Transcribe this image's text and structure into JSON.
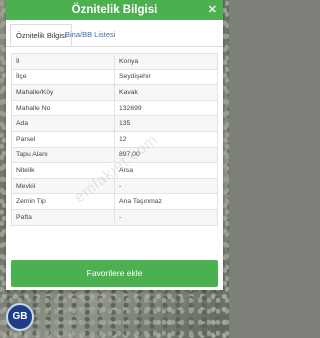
{
  "dialog": {
    "title": "Öznitelik Bilgisi",
    "close_icon_glyph": "✕",
    "tabs": [
      {
        "label": "Öznitelik Bilgisi"
      },
      {
        "label": "Bina/BB Listesi"
      }
    ],
    "rows": [
      {
        "label": "İl",
        "value": "Konya"
      },
      {
        "label": "İlçe",
        "value": "Seydişehir"
      },
      {
        "label": "Mahalle/Köy",
        "value": "Kavak"
      },
      {
        "label": "Mahalle No",
        "value": "132699"
      },
      {
        "label": "Ada",
        "value": "135"
      },
      {
        "label": "Parsel",
        "value": "12"
      },
      {
        "label": "Tapu Alanı",
        "value": "897,00"
      },
      {
        "label": "Nitelik",
        "value": "Arsa"
      },
      {
        "label": "Mevkii",
        "value": "-"
      },
      {
        "label": "Zemin Tip",
        "value": "Ana Taşınmaz"
      },
      {
        "label": "Pafta",
        "value": "-"
      }
    ],
    "favorite_button": "Favorilere ekle"
  },
  "watermark": "emlakjet.com",
  "logo_text": "GB",
  "colors": {
    "accent": "#4caf50",
    "tab_link": "#3a6ea5",
    "logo": "#1f3e8a"
  }
}
